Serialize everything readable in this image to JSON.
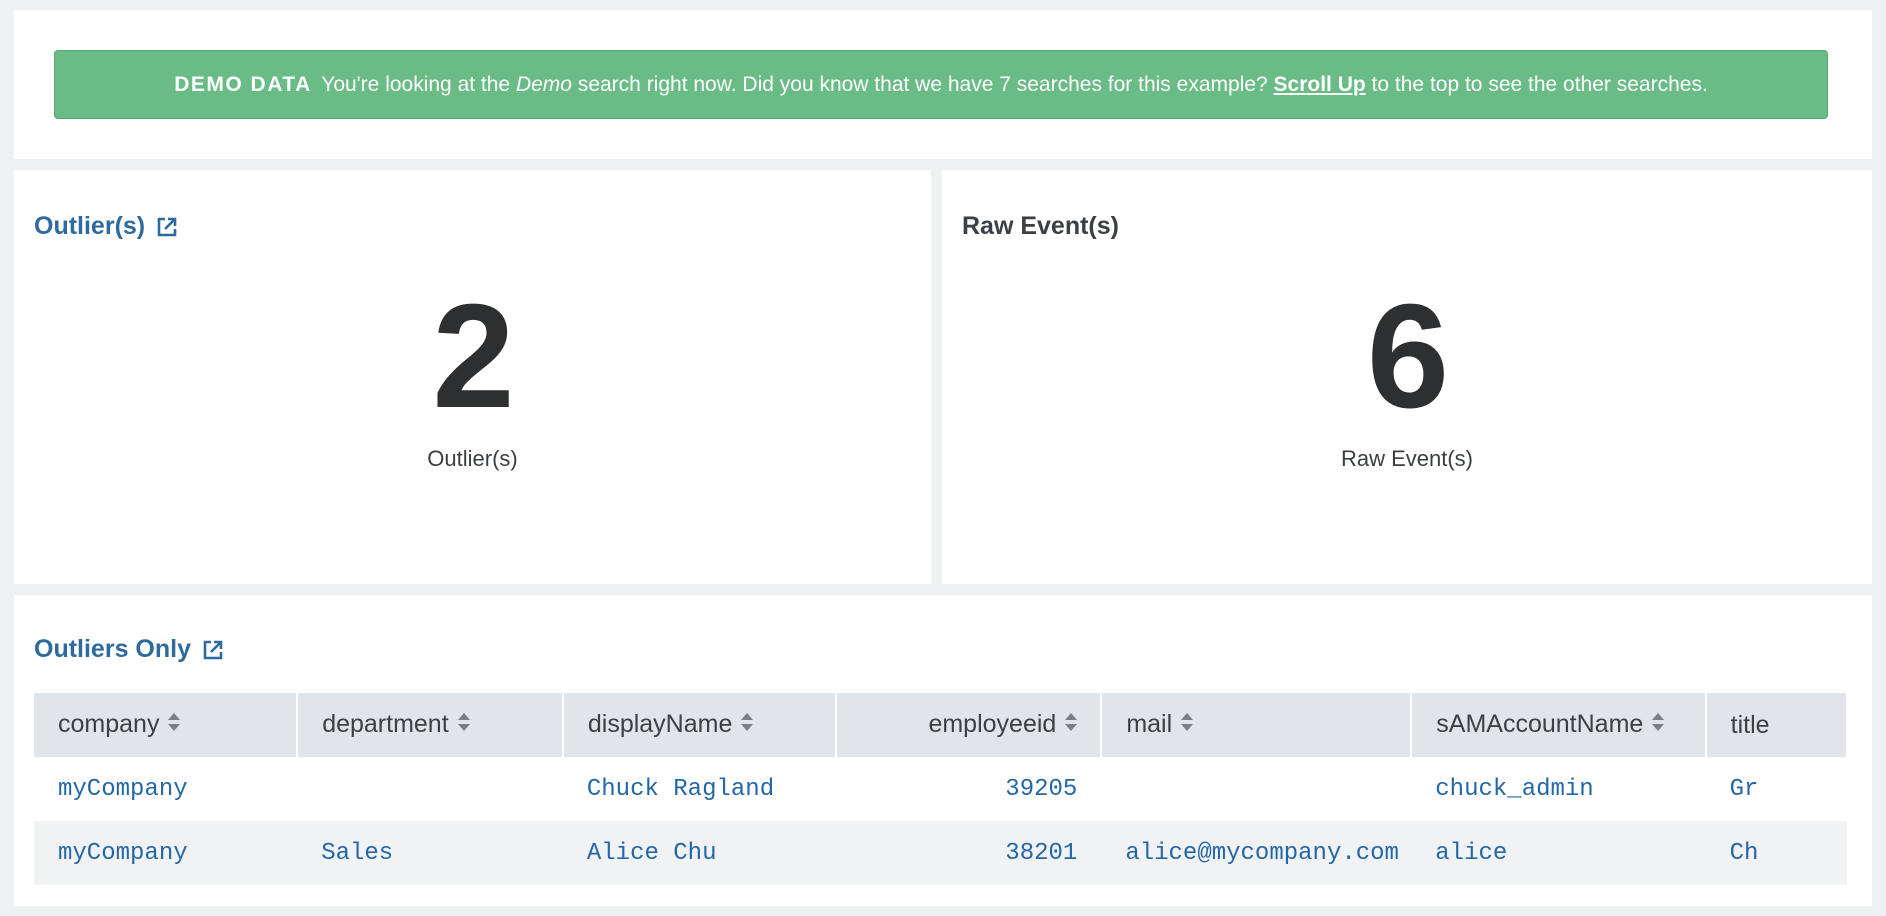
{
  "banner": {
    "tag": "DEMO DATA",
    "text_1": "You're looking at the ",
    "emphasis": "Demo",
    "text_2": " search right now. Did you know that we have 7 searches for this example? ",
    "link": "Scroll Up",
    "text_3": " to the top to see the other searches.",
    "color": "#6abc87"
  },
  "outliers_panel": {
    "title": "Outlier(s)",
    "value": "2",
    "caption": "Outlier(s)"
  },
  "raw_panel": {
    "title": "Raw Event(s)",
    "value": "6",
    "caption": "Raw Event(s)"
  },
  "table_panel": {
    "title": "Outliers Only",
    "columns": [
      "company",
      "department",
      "displayName",
      "employeeid",
      "mail",
      "sAMAccountName",
      "title"
    ],
    "rows": [
      [
        "myCompany",
        "",
        "Chuck Ragland",
        "39205",
        "",
        "chuck_admin",
        "Gr"
      ],
      [
        "myCompany",
        "Sales",
        "Alice Chu",
        "38201",
        "alice@mycompany.com",
        "alice",
        "Ch"
      ]
    ]
  },
  "icons": {
    "title_link": "external-link-icon",
    "column_sort": "sort-icon"
  },
  "colors": {
    "link": "#2f6a9e",
    "cell_text": "#2467a7",
    "header_bg": "#e1e4e8"
  }
}
